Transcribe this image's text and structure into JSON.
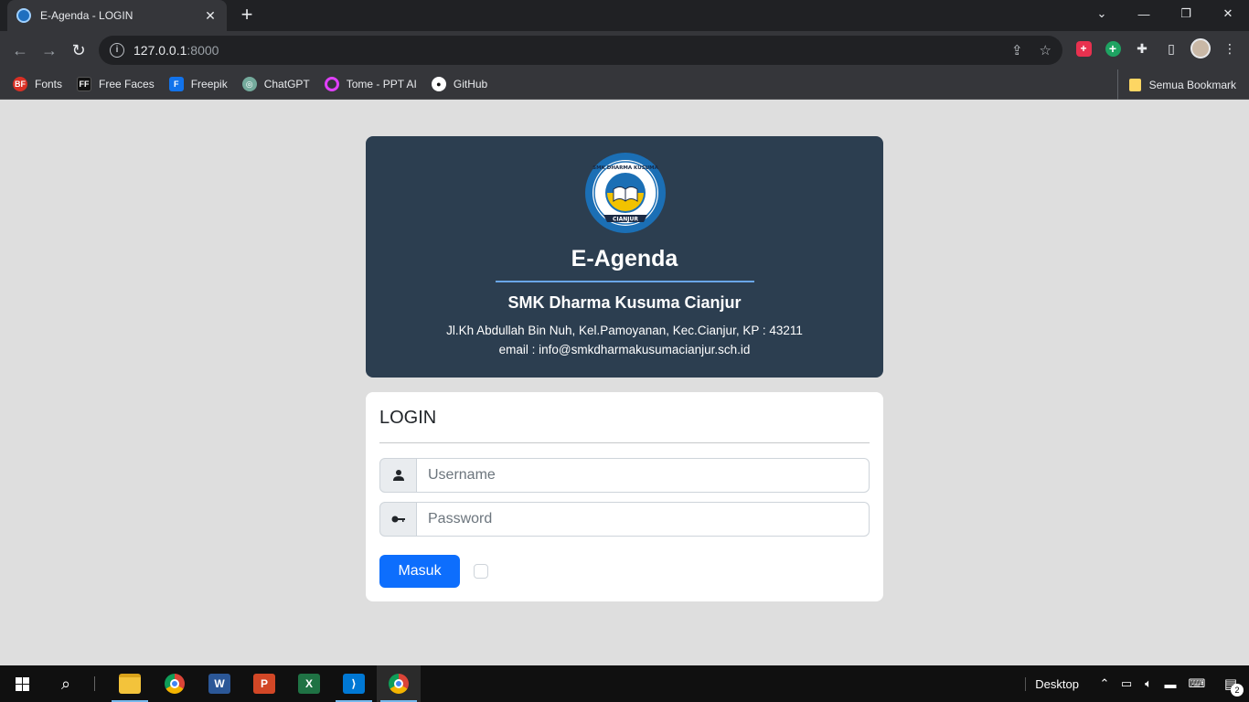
{
  "browser": {
    "tab_title": "E-Agenda - LOGIN",
    "url_host": "127.0.0.1",
    "url_port": ":8000",
    "bookmarks": [
      {
        "label": "Fonts",
        "icon": "bf-icon",
        "color": "#d93025"
      },
      {
        "label": "Free Faces",
        "icon": "ff-icon",
        "color": "#111111"
      },
      {
        "label": "Freepik",
        "icon": "freepik-icon",
        "color": "#1273eb"
      },
      {
        "label": "ChatGPT",
        "icon": "chatgpt-icon",
        "color": "#74aa9c"
      },
      {
        "label": "Tome - PPT AI",
        "icon": "tome-icon",
        "color": "#e040fb"
      },
      {
        "label": "GitHub",
        "icon": "github-icon",
        "color": "#ffffff"
      }
    ],
    "bookmarks_folder": "Semua Bookmark"
  },
  "header": {
    "app_title": "E-Agenda",
    "school_name": "SMK Dharma Kusuma Cianjur",
    "address": "Jl.Kh Abdullah Bin Nuh, Kel.Pamoyanan, Kec.Cianjur, KP : 43211",
    "email": "email : info@smkdharmakusumacianjur.sch.id",
    "logo_text_top": "SMK DHARMA KUSUMA",
    "logo_text_bottom": "CIANJUR"
  },
  "login": {
    "heading": "LOGIN",
    "username_placeholder": "Username",
    "password_placeholder": "Password",
    "submit_label": "Masuk"
  },
  "taskbar": {
    "desktop_label": "Desktop",
    "notification_count": "2",
    "word_letter": "W",
    "ppt_letter": "P",
    "excel_letter": "X"
  },
  "colors": {
    "header_bg": "#2c3e50",
    "page_bg": "#dedede",
    "primary_button": "#0d6efd",
    "title_rule": "#6aa6e8"
  }
}
